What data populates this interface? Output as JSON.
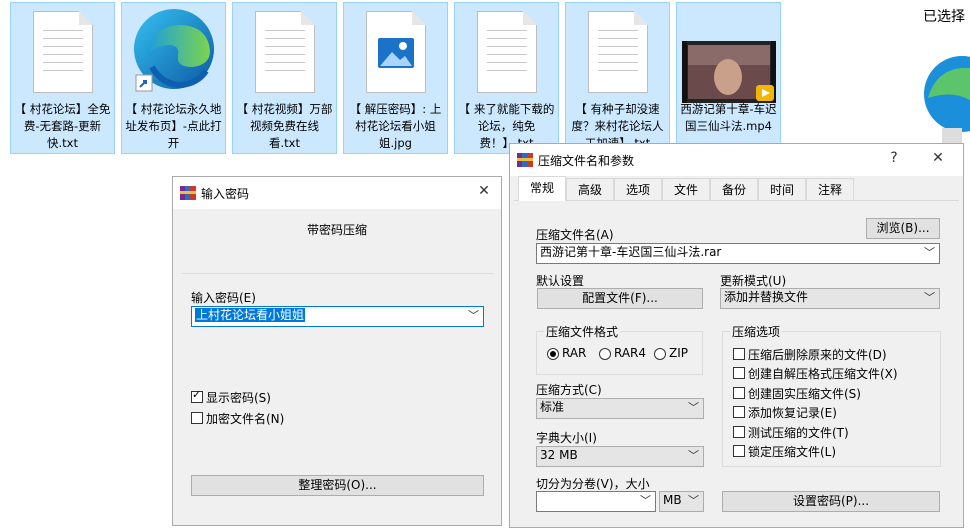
{
  "desktop": {
    "files": [
      {
        "name": "【 村花论坛】全免费-无套路-更新快.txt",
        "type": "txt"
      },
      {
        "name": "【 村花论坛永久地址发布页】-点此打开",
        "type": "edge"
      },
      {
        "name": "【 村花视频】万部视频免费在线看.txt",
        "type": "txt"
      },
      {
        "name": "【 解压密码】: 上村花论坛看小姐姐.jpg",
        "type": "jpg"
      },
      {
        "name": "【 来了就能下载的论坛，纯免费！】.txt",
        "type": "txt"
      },
      {
        "name": "【 有种子却没速度？来村花论坛人工加速】.txt",
        "type": "txt"
      },
      {
        "name": "西游记第十章-车迟国三仙斗法.mp4",
        "type": "mp4"
      }
    ],
    "right_panel_title": "已选择"
  },
  "password_dialog": {
    "title": "输入密码",
    "heading": "带密码压缩",
    "password_label": "输入密码(E)",
    "password_value": "上村花论坛看小姐姐",
    "show_password_label": "显示密码(S)",
    "show_password_checked": true,
    "encrypt_names_label": "加密文件名(N)",
    "encrypt_names_checked": false,
    "organize_button": "整理密码(O)..."
  },
  "archive_dialog": {
    "title": "压缩文件名和参数",
    "help": "?",
    "close": "✕",
    "tabs": [
      "常规",
      "高级",
      "选项",
      "文件",
      "备份",
      "时间",
      "注释"
    ],
    "active_tab": "常规",
    "archive_name_label": "压缩文件名(A)",
    "browse_button": "浏览(B)...",
    "archive_name_value": "西游记第十章-车迟国三仙斗法.rar",
    "default_settings_label": "默认设置",
    "profiles_button": "配置文件(F)...",
    "update_mode_label": "更新模式(U)",
    "update_mode_value": "添加并替换文件",
    "format_group_title": "压缩文件格式",
    "formats": [
      "RAR",
      "RAR4",
      "ZIP"
    ],
    "selected_format": "RAR",
    "options_group_title": "压缩选项",
    "options": [
      {
        "label": "压缩后删除原来的文件(D)",
        "checked": false
      },
      {
        "label": "创建自解压格式压缩文件(X)",
        "checked": false
      },
      {
        "label": "创建固实压缩文件(S)",
        "checked": false
      },
      {
        "label": "添加恢复记录(E)",
        "checked": false
      },
      {
        "label": "测试压缩的文件(T)",
        "checked": false
      },
      {
        "label": "锁定压缩文件(L)",
        "checked": false
      }
    ],
    "method_label": "压缩方式(C)",
    "method_value": "标准",
    "dict_label": "字典大小(I)",
    "dict_value": "32 MB",
    "split_label": "切分为分卷(V)，大小",
    "split_value": "",
    "split_unit": "MB",
    "set_password_button": "设置密码(P)..."
  },
  "colors": {
    "selection": "#cce8ff",
    "selection_border": "#99d1ff",
    "input_highlight": "#0078d7",
    "dialog_bg": "#f0f0f0"
  }
}
